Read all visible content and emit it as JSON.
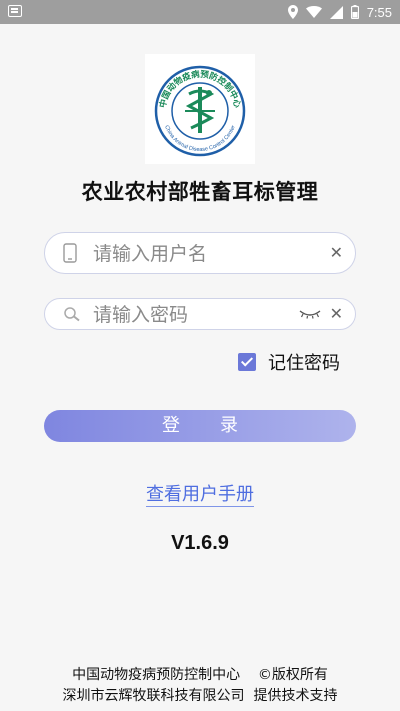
{
  "status_bar": {
    "time": "7:55"
  },
  "app_title": "农业农村部牲畜耳标管理",
  "logo": {
    "text_cn": "中国动物疫病预防控制中心",
    "text_en": "China Animal Disease Control Center"
  },
  "login": {
    "username_placeholder": "请输入用户名",
    "password_placeholder": "请输入密码",
    "remember_label": "记住密码",
    "remember_checked": true,
    "login_button": "登录"
  },
  "manual_link": "查看用户手册",
  "version": "V1.6.9",
  "footer": {
    "line1": "中国动物疫病预防控制中心    ©版权所有",
    "line2": "深圳市云辉牧联科技有限公司  提供技术支持"
  },
  "colors": {
    "accent": "#6b78d8",
    "link": "#4f6ee0",
    "logo_green": "#1b8a5a",
    "logo_blue": "#1f5fa8"
  }
}
